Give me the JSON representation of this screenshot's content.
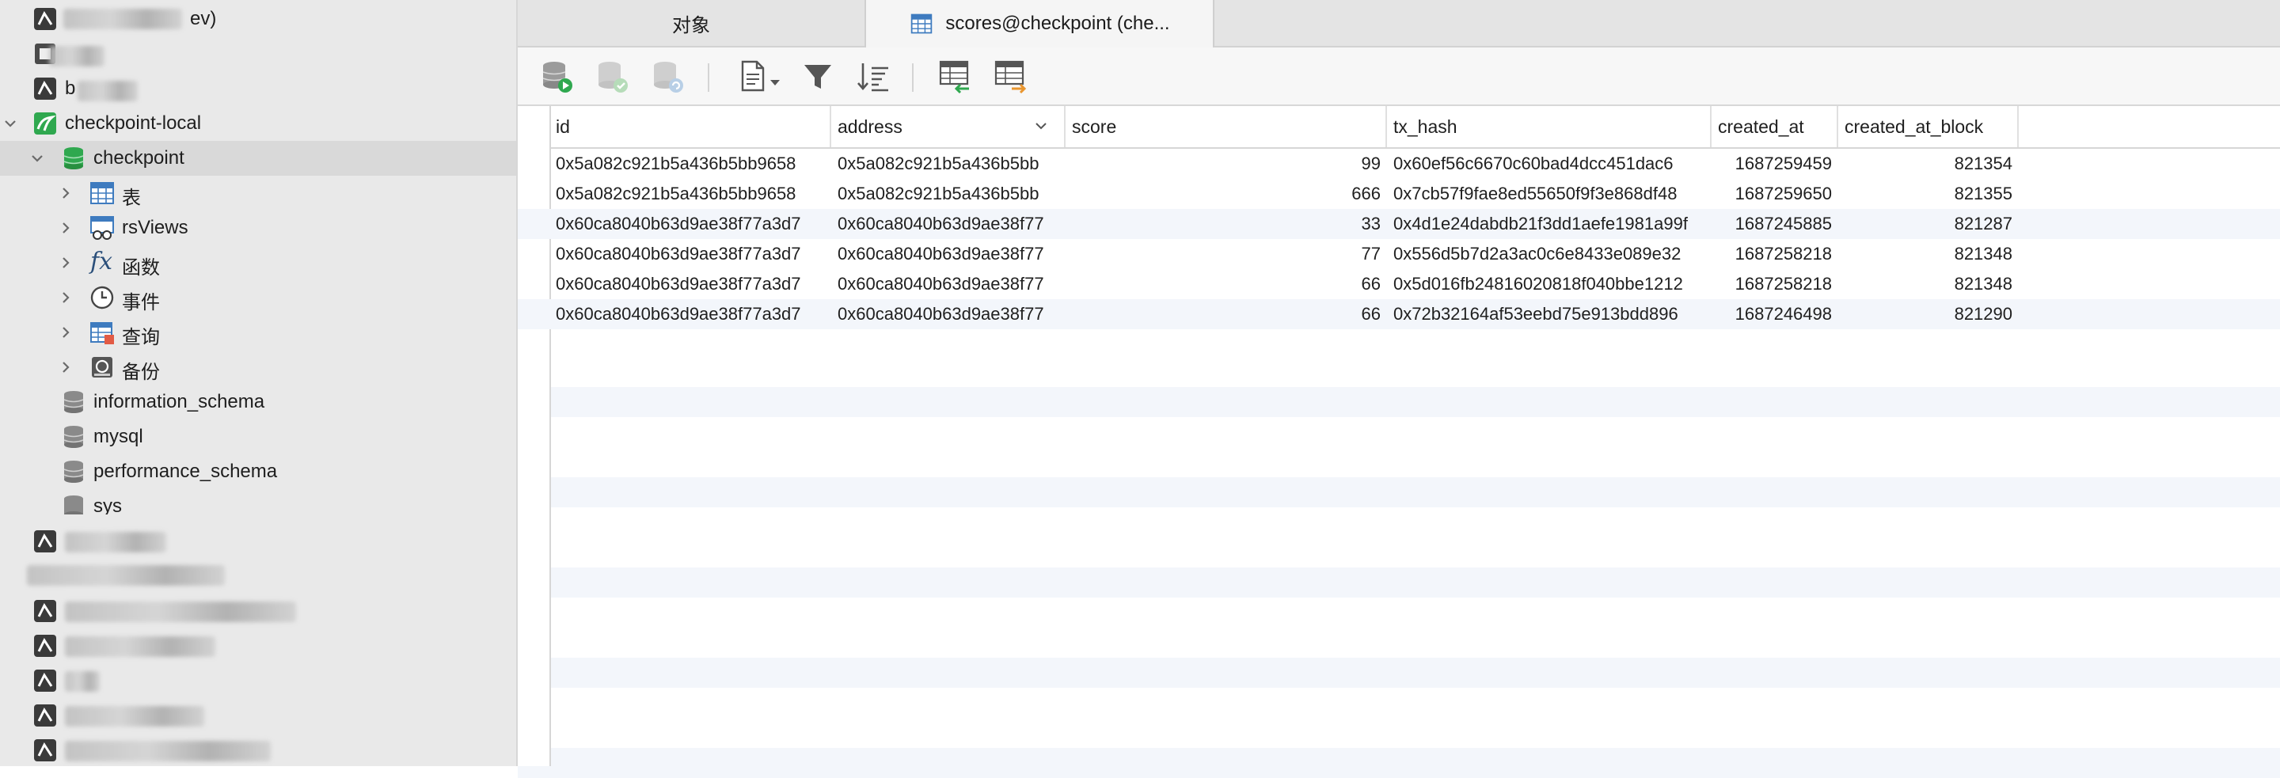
{
  "sidebar": {
    "items": [
      {
        "label": "ev)",
        "blurred_prefix": true
      },
      {
        "label": "",
        "blurred_prefix": true
      },
      {
        "label": "b",
        "blurred_prefix": true
      },
      {
        "label": "checkpoint-local"
      },
      {
        "label": "checkpoint"
      },
      {
        "label": "表"
      },
      {
        "label": "rsViews"
      },
      {
        "label": "函数"
      },
      {
        "label": "事件"
      },
      {
        "label": "查询"
      },
      {
        "label": "备份"
      },
      {
        "label": "information_schema"
      },
      {
        "label": "mysql"
      },
      {
        "label": "performance_schema"
      },
      {
        "label": "sys"
      }
    ]
  },
  "tabs": [
    {
      "label": "对象"
    },
    {
      "label": "scores@checkpoint (che..."
    }
  ],
  "toolbar": {
    "icons": [
      "db-run-icon",
      "db-commit-icon",
      "db-refresh-icon",
      "document-icon",
      "filter-icon",
      "sort-icon",
      "import-table-icon",
      "export-table-icon"
    ]
  },
  "grid": {
    "columns": [
      "id",
      "address",
      "score",
      "tx_hash",
      "created_at",
      "created_at_block"
    ],
    "rows": [
      [
        "0x5a082c921b5a436b5bb9658",
        "0x5a082c921b5a436b5bb",
        "99",
        "0x60ef56c6670c60bad4dcc451dac6",
        "1687259459",
        "821354"
      ],
      [
        "0x5a082c921b5a436b5bb9658",
        "0x5a082c921b5a436b5bb",
        "666",
        "0x7cb57f9fae8ed55650f9f3e868df48",
        "1687259650",
        "821355"
      ],
      [
        "0x60ca8040b63d9ae38f77a3d7",
        "0x60ca8040b63d9ae38f77",
        "33",
        "0x4d1e24dabdb21f3dd1aefe1981a99f",
        "1687245885",
        "821287"
      ],
      [
        "0x60ca8040b63d9ae38f77a3d7",
        "0x60ca8040b63d9ae38f77",
        "77",
        "0x556d5b7d2a3ac0c6e8433e089e32",
        "1687258218",
        "821348"
      ],
      [
        "0x60ca8040b63d9ae38f77a3d7",
        "0x60ca8040b63d9ae38f77",
        "66",
        "0x5d016fb24816020818f040bbe1212",
        "1687258218",
        "821348"
      ],
      [
        "0x60ca8040b63d9ae38f77a3d7",
        "0x60ca8040b63d9ae38f77",
        "66",
        "0x72b32164af53eebd75e913bdd896",
        "1687246498",
        "821290"
      ]
    ]
  },
  "colors": {
    "mysql_green": "#2fa84f",
    "table_blue": "#3e7bbf",
    "selection": "#d9d9d9",
    "stripe": "#f3f6fb"
  }
}
